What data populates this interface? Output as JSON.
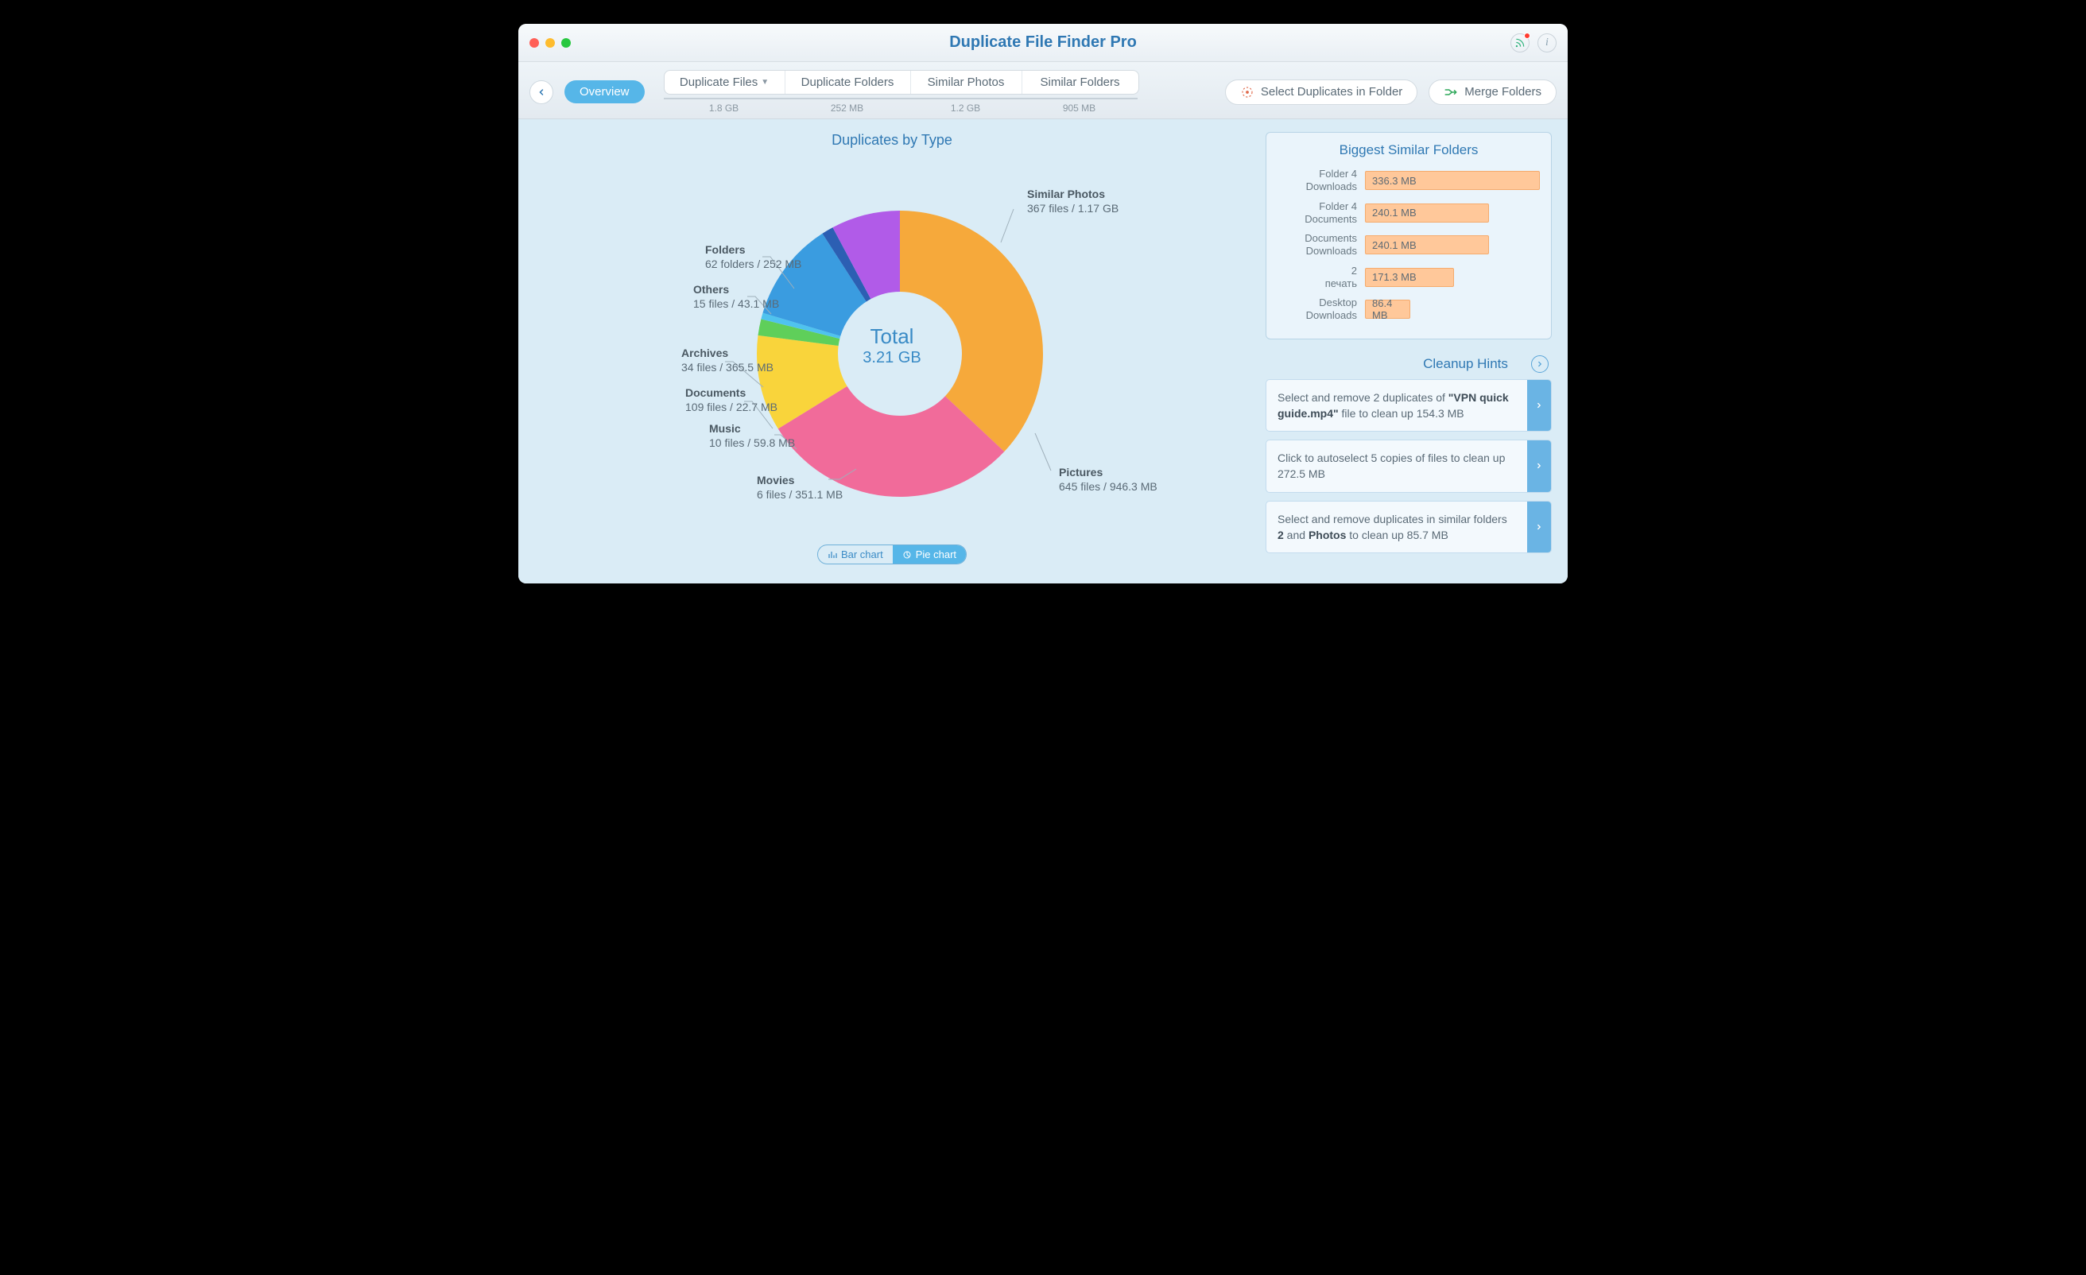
{
  "title": "Duplicate File Finder Pro",
  "toolbar": {
    "overview_label": "Overview",
    "select_in_folder_label": "Select Duplicates in Folder",
    "merge_folders_label": "Merge Folders"
  },
  "tabs": [
    {
      "label": "Duplicate Files",
      "size": "1.8 GB",
      "has_dropdown": true,
      "width": 152
    },
    {
      "label": "Duplicate Folders",
      "size": "252 MB",
      "has_dropdown": false,
      "width": 158
    },
    {
      "label": "Similar Photos",
      "size": "1.2 GB",
      "has_dropdown": false,
      "width": 140
    },
    {
      "label": "Similar Folders",
      "size": "905 MB",
      "has_dropdown": false,
      "width": 146
    }
  ],
  "chart_title": "Duplicates by Type",
  "total": {
    "label": "Total",
    "value": "3.21 GB"
  },
  "chart_toggle": {
    "bar": "Bar chart",
    "pie": "Pie chart",
    "active": "pie"
  },
  "chart_data": {
    "type": "pie",
    "title": "Duplicates by Type",
    "total_label": "Total",
    "total_value": "3.21 GB",
    "series": [
      {
        "name": "Similar Photos",
        "files": 367,
        "unit": "files",
        "size": "1.17 GB",
        "size_mb": 1198,
        "color": "#f6a93b"
      },
      {
        "name": "Pictures",
        "files": 645,
        "unit": "files",
        "size": "946.3 MB",
        "size_mb": 946.3,
        "color": "#f16b9a"
      },
      {
        "name": "Movies",
        "files": 6,
        "unit": "files",
        "size": "351.1 MB",
        "size_mb": 351.1,
        "color": "#f9d43b"
      },
      {
        "name": "Music",
        "files": 10,
        "unit": "files",
        "size": "59.8 MB",
        "size_mb": 59.8,
        "color": "#5fcf5a"
      },
      {
        "name": "Documents",
        "files": 109,
        "unit": "files",
        "size": "22.7 MB",
        "size_mb": 22.7,
        "color": "#4fc3ee"
      },
      {
        "name": "Archives",
        "files": 34,
        "unit": "files",
        "size": "365.5 MB",
        "size_mb": 365.5,
        "color": "#3a9ce0"
      },
      {
        "name": "Others",
        "files": 15,
        "unit": "files",
        "size": "43.1 MB",
        "size_mb": 43.1,
        "color": "#2c5fb3"
      },
      {
        "name": "Folders",
        "files": 62,
        "unit": "folders",
        "size": "252 MB",
        "size_mb": 252,
        "color": "#b15be8"
      }
    ]
  },
  "biggest_similar": {
    "title": "Biggest Similar Folders",
    "rows": [
      {
        "label1": "Folder 4",
        "label2": "Downloads",
        "size": "336.3 MB",
        "pct": 100
      },
      {
        "label1": "Folder 4",
        "label2": "Documents",
        "size": "240.1 MB",
        "pct": 71
      },
      {
        "label1": "Documents",
        "label2": "Downloads",
        "size": "240.1 MB",
        "pct": 71
      },
      {
        "label1": "2",
        "label2": "печать",
        "size": "171.3 MB",
        "pct": 51
      },
      {
        "label1": "Desktop",
        "label2": "Downloads",
        "size": "86.4 MB",
        "pct": 26
      }
    ]
  },
  "hints": {
    "title": "Cleanup Hints",
    "items": [
      {
        "pre": "Select and remove 2 duplicates of ",
        "bold": "\"VPN quick guide.mp4\"",
        "post": " file to clean up 154.3 MB"
      },
      {
        "pre": "Click to autoselect 5 copies of files to clean up 272.5 MB",
        "bold": "",
        "post": ""
      },
      {
        "pre": "Select and remove duplicates in similar folders ",
        "bold": "2",
        "mid": " and ",
        "bold2": "Photos",
        "post": " to clean up 85.7 MB"
      }
    ]
  }
}
